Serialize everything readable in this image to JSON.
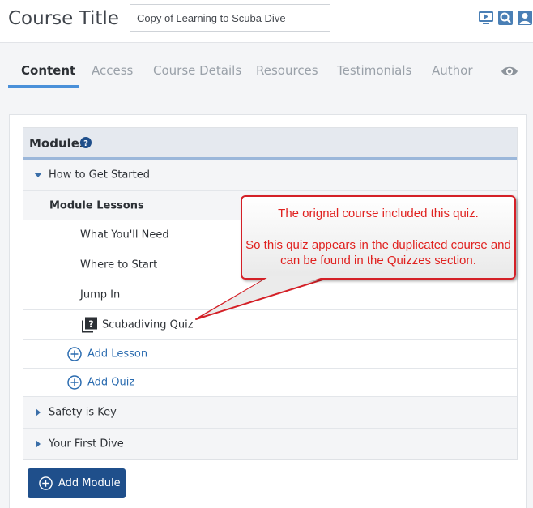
{
  "header": {
    "course_title_label": "Course Title",
    "title_input_value": "Copy of Learning to Scuba Dive",
    "icons": [
      "video-preview-icon",
      "search-preview-icon",
      "user-preview-icon"
    ]
  },
  "tabs": [
    {
      "label": "Content",
      "active": true
    },
    {
      "label": "Access",
      "active": false
    },
    {
      "label": "Course Details",
      "active": false
    },
    {
      "label": "Resources",
      "active": false
    },
    {
      "label": "Testimonials",
      "active": false
    },
    {
      "label": "Author",
      "active": false
    }
  ],
  "modules": {
    "title": "Modules",
    "items": [
      {
        "name": "How to Get Started",
        "expanded": true,
        "sub_header": "Module Lessons",
        "lessons": [
          "What You'll Need",
          "Where to Start",
          "Jump In"
        ],
        "quiz": "Scubadiving Quiz",
        "add_lesson_label": "Add Lesson",
        "add_quiz_label": "Add Quiz"
      },
      {
        "name": "Safety is Key",
        "expanded": false
      },
      {
        "name": "Your First Dive",
        "expanded": false
      }
    ],
    "add_module_label": "Add Module"
  },
  "callout": {
    "line1": "The orignal course included this quiz.",
    "line2": "So this quiz appears in the duplicated course and can be found in the Quizzes section."
  },
  "colors": {
    "accent": "#4a90d9",
    "link": "#2b6cb0",
    "button": "#1f4f8b",
    "callout_red": "#d42027"
  }
}
